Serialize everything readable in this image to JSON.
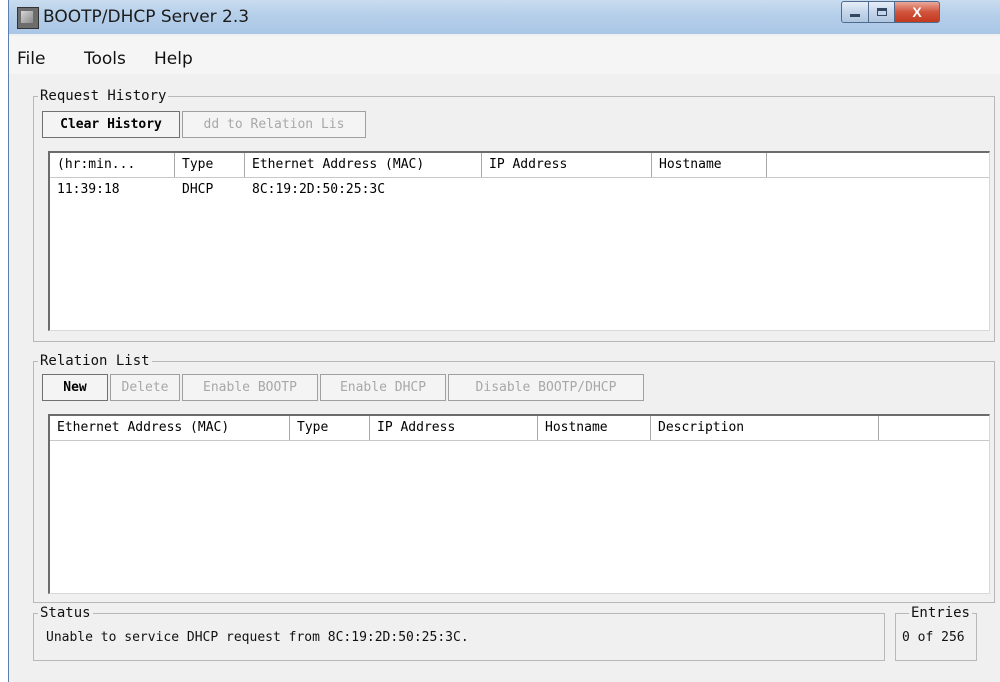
{
  "window": {
    "title": "BOOTP/DHCP Server 2.3",
    "controls": {
      "minimize": "minimize",
      "maximize": "maximize",
      "close": "X"
    }
  },
  "menu": {
    "items": [
      "File",
      "Tools",
      "Help"
    ]
  },
  "request_history": {
    "label": "Request History",
    "buttons": {
      "clear_history": "Clear History",
      "add_to_relation_list": "dd to Relation Lis"
    },
    "columns": [
      "(hr:min...",
      "Type",
      "Ethernet Address (MAC)",
      "IP Address",
      "Hostname"
    ],
    "rows": [
      {
        "time": "11:39:18",
        "type": "DHCP",
        "mac": "8C:19:2D:50:25:3C",
        "ip": "",
        "hostname": ""
      }
    ]
  },
  "relation_list": {
    "label": "Relation List",
    "buttons": {
      "new": "New",
      "delete": "Delete",
      "enable_bootp": "Enable BOOTP",
      "enable_dhcp": "Enable DHCP",
      "disable_bootp_dhcp": "Disable BOOTP/DHCP"
    },
    "columns": [
      "Ethernet Address (MAC)",
      "Type",
      "IP Address",
      "Hostname",
      "Description"
    ],
    "rows": []
  },
  "status": {
    "label": "Status",
    "message": "Unable to service DHCP request from 8C:19:2D:50:25:3C."
  },
  "entries": {
    "label": "Entries",
    "value": "0 of 256"
  },
  "colors": {
    "title_bar": "#b7d0ea",
    "close_button": "#c2391f",
    "window_bg": "#f0f0f0"
  }
}
